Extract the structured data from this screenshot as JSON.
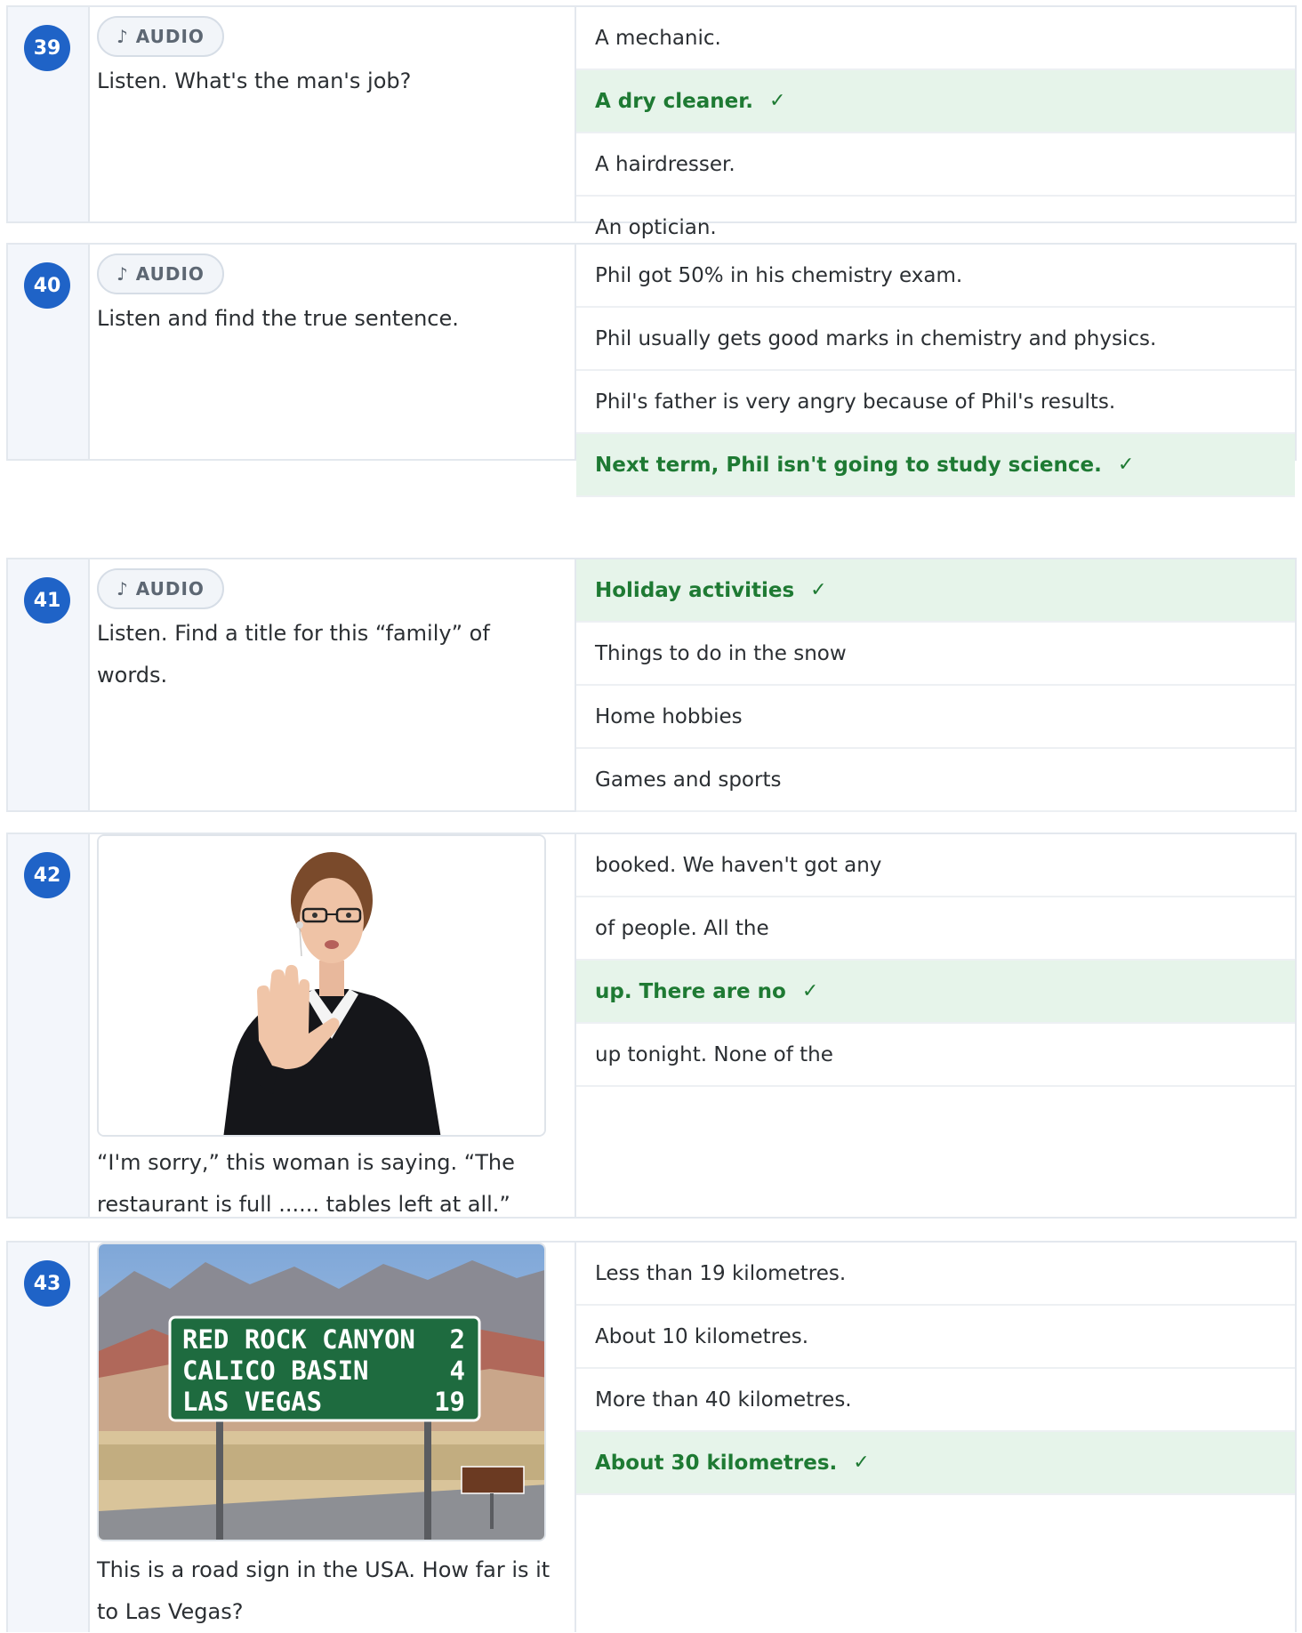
{
  "audio_label": "AUDIO",
  "check_mark": "✓",
  "questions": [
    {
      "number": "39",
      "prompt": "Listen. What's the man's job?",
      "options": [
        "A mechanic.",
        "A dry cleaner.",
        "A hairdresser.",
        "An optician."
      ],
      "correct_index": 1
    },
    {
      "number": "40",
      "prompt": "Listen and find the true sentence.",
      "options": [
        "Phil got 50% in his chemistry exam.",
        "Phil usually gets good marks in chemistry and physics.",
        "Phil's father is very angry because of Phil's results.",
        "Next term, Phil isn't going to study science."
      ],
      "correct_index": 3
    },
    {
      "number": "41",
      "prompt": "Listen. Find a title for this “family” of words.",
      "options": [
        "Holiday activities",
        "Things to do in the snow",
        "Home hobbies",
        "Games and sports"
      ],
      "correct_index": 0
    },
    {
      "number": "42",
      "prompt": "“I'm sorry,” this woman is saying. “The restaurant is full ...... tables left at all.”",
      "options": [
        "booked. We haven't got any",
        "of people. All the",
        "up. There are no",
        "up tonight. None of the"
      ],
      "correct_index": 2
    },
    {
      "number": "43",
      "prompt": "This is a road sign in the USA. How far is it to Las Vegas?",
      "options": [
        "Less than 19 kilometres.",
        "About 10 kilometres.",
        "More than 40 kilometres.",
        "About 30 kilometres."
      ],
      "correct_index": 3,
      "sign": {
        "rows": [
          [
            "RED ROCK CANYON",
            "2"
          ],
          [
            "CALICO BASIN",
            "4"
          ],
          [
            "LAS VEGAS",
            "19"
          ]
        ]
      }
    }
  ]
}
